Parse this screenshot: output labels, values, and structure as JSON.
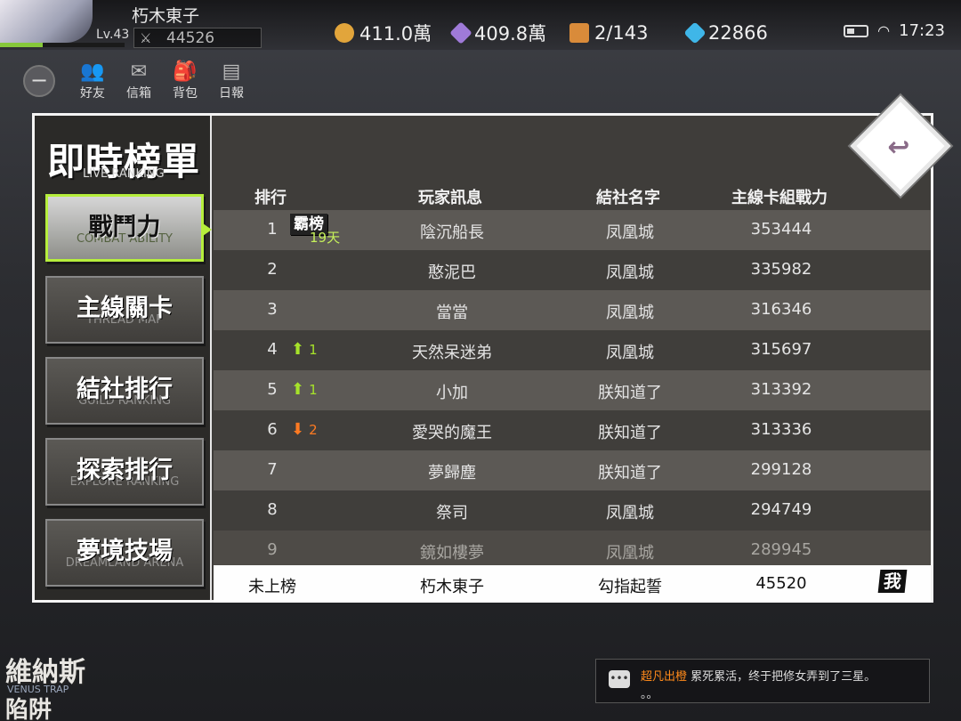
{
  "hud": {
    "player_name": "朽木東子",
    "level": "Lv.43",
    "power": "44526",
    "xp_fraction": 0.34,
    "resources": [
      {
        "name": "gold-coin",
        "value": "411.0萬",
        "color": "#e2a53b"
      },
      {
        "name": "crystal",
        "value": "409.8萬",
        "color": "#9f7ad8"
      },
      {
        "name": "chest",
        "value": "2/143",
        "color": "#d98b3a"
      },
      {
        "name": "diamond",
        "value": "22866",
        "color": "#3fb6e8"
      }
    ],
    "time": "17:23"
  },
  "quick_menu": {
    "items": [
      {
        "label": "好友",
        "icon": "friends-icon",
        "glyph": "👥"
      },
      {
        "label": "信箱",
        "icon": "mail-icon",
        "glyph": "✉"
      },
      {
        "label": "背包",
        "icon": "backpack-icon",
        "glyph": "🎒"
      },
      {
        "label": "日報",
        "icon": "report-icon",
        "glyph": "▤"
      }
    ],
    "toggle_glyph": "−"
  },
  "ranking": {
    "title": "即時榜單",
    "subtitle": "LIVE RANKING",
    "tabs": [
      {
        "label": "戰鬥力",
        "en": "COMBAT ABILITY",
        "active": true
      },
      {
        "label": "主線關卡",
        "en": "THREAD MAP",
        "active": false
      },
      {
        "label": "結社排行",
        "en": "GUILD RANKING",
        "active": false
      },
      {
        "label": "探索排行",
        "en": "EXPLORE RANKING",
        "active": false
      },
      {
        "label": "夢境技場",
        "en": "DREAMLAND ARENA",
        "active": false
      }
    ],
    "columns": {
      "rank": "排行",
      "player": "玩家訊息",
      "guild": "結社名字",
      "power": "主線卡組戰力"
    },
    "rows": [
      {
        "rank": "1",
        "name": "陰沉船長",
        "guild": "凤凰城",
        "power": "353444",
        "badge": "霸榜",
        "badge_days": "19天"
      },
      {
        "rank": "2",
        "name": "憨泥巴",
        "guild": "凤凰城",
        "power": "335982"
      },
      {
        "rank": "3",
        "name": "當當",
        "guild": "凤凰城",
        "power": "316346"
      },
      {
        "rank": "4",
        "name": "天然呆迷弟",
        "guild": "凤凰城",
        "power": "315697",
        "trend": "up",
        "change": "1"
      },
      {
        "rank": "5",
        "name": "小加",
        "guild": "朕知道了",
        "power": "313392",
        "trend": "up",
        "change": "1"
      },
      {
        "rank": "6",
        "name": "愛哭的魔王",
        "guild": "朕知道了",
        "power": "313336",
        "trend": "down",
        "change": "2"
      },
      {
        "rank": "7",
        "name": "夢歸塵",
        "guild": "朕知道了",
        "power": "299128"
      },
      {
        "rank": "8",
        "name": "祭司",
        "guild": "凤凰城",
        "power": "294749"
      },
      {
        "rank": "9",
        "name": "鏡如樓夢",
        "guild": "凤凰城",
        "power": "289945"
      }
    ],
    "me": {
      "rank": "未上榜",
      "name": "朽木東子",
      "guild": "勾指起誓",
      "power": "45520",
      "tag": "我"
    },
    "back_glyph": "↩"
  },
  "event": {
    "line1": "維納斯",
    "line2": "VENUS TRAP",
    "line3": "陷阱"
  },
  "chat": {
    "sender": "超凡出橙",
    "message": "累死累活，终于把修女弄到了三星。",
    "line2": "。。"
  }
}
